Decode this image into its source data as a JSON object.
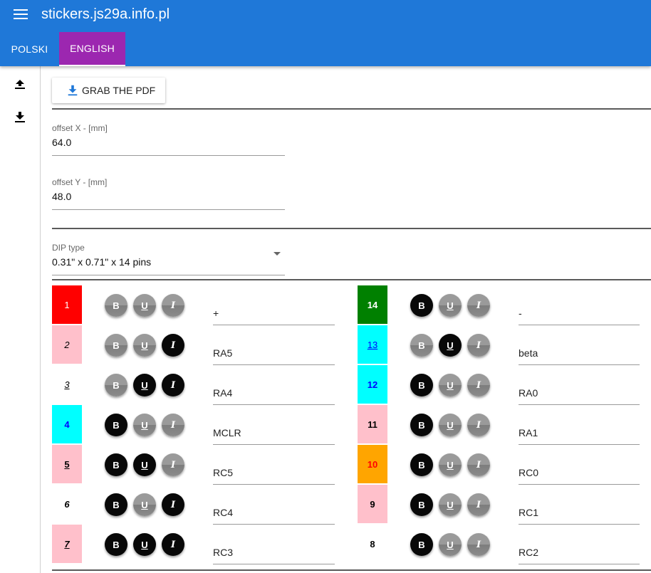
{
  "appbar": {
    "title": "stickers.js29a.info.pl",
    "menu_icon": "hamburger-menu-icon",
    "tabs": [
      {
        "label": "POLSKI",
        "active": false
      },
      {
        "label": "ENGLISH",
        "active": true
      }
    ]
  },
  "sidebar": {
    "upload_icon": "upload-icon",
    "download_icon": "download-icon"
  },
  "toolbar": {
    "grab_pdf_label": "GRAB THE PDF",
    "grab_pdf_icon": "download-icon"
  },
  "settings": {
    "offset_x": {
      "label": "offset X - [mm]",
      "value": "64.0"
    },
    "offset_y": {
      "label": "offset Y - [mm]",
      "value": "48.0"
    },
    "dip_type": {
      "label": "DIP type",
      "value": "0.31\" x 0.71\" x 14 pins"
    }
  },
  "colors": {
    "appbar": "#1f78d8",
    "active_tab": "#9c27b0",
    "red": "#ff0000",
    "pink": "#ffc0cb",
    "cyan": "#00ffff",
    "green": "#008000",
    "orange": "#ffa500",
    "white": "#ffffff",
    "blue_text": "#0000ff"
  },
  "pins_left": [
    {
      "number": "1",
      "bg": "#ff0000",
      "fg": "#ffffff",
      "bold": false,
      "underline": false,
      "italic": false,
      "text": "+"
    },
    {
      "number": "2",
      "bg": "#ffc0cb",
      "fg": "#000000",
      "bold": false,
      "underline": false,
      "italic": true,
      "text": "RA5"
    },
    {
      "number": "3",
      "bg": "#ffffff",
      "fg": "#000000",
      "bold": false,
      "underline": true,
      "italic": true,
      "text": "RA4"
    },
    {
      "number": "4",
      "bg": "#00ffff",
      "fg": "#0000ff",
      "bold": true,
      "underline": false,
      "italic": false,
      "text": "MCLR"
    },
    {
      "number": "5",
      "bg": "#ffc0cb",
      "fg": "#000000",
      "bold": true,
      "underline": true,
      "italic": false,
      "text": "RC5"
    },
    {
      "number": "6",
      "bg": "#ffffff",
      "fg": "#000000",
      "bold": true,
      "underline": false,
      "italic": true,
      "text": "RC4"
    },
    {
      "number": "7",
      "bg": "#ffc0cb",
      "fg": "#000000",
      "bold": true,
      "underline": true,
      "italic": true,
      "text": "RC3"
    }
  ],
  "pins_right": [
    {
      "number": "14",
      "bg": "#008000",
      "fg": "#ffffff",
      "bold": true,
      "underline": false,
      "italic": false,
      "text": "-"
    },
    {
      "number": "13",
      "bg": "#00ffff",
      "fg": "#0000ff",
      "bold": false,
      "underline": true,
      "italic": false,
      "text": "beta"
    },
    {
      "number": "12",
      "bg": "#00ffff",
      "fg": "#0000ff",
      "bold": true,
      "underline": false,
      "italic": false,
      "text": "RA0"
    },
    {
      "number": "11",
      "bg": "#ffc0cb",
      "fg": "#000000",
      "bold": true,
      "underline": false,
      "italic": false,
      "text": "RA1"
    },
    {
      "number": "10",
      "bg": "#ffa500",
      "fg": "#ff0000",
      "bold": true,
      "underline": false,
      "italic": false,
      "text": "RC0"
    },
    {
      "number": "9",
      "bg": "#ffc0cb",
      "fg": "#000000",
      "bold": true,
      "underline": false,
      "italic": false,
      "text": "RC1"
    },
    {
      "number": "8",
      "bg": "#ffffff",
      "fg": "#000000",
      "bold": true,
      "underline": false,
      "italic": false,
      "text": "RC2"
    }
  ],
  "format_buttons": {
    "bold": "B",
    "underline": "U",
    "italic": "I"
  }
}
